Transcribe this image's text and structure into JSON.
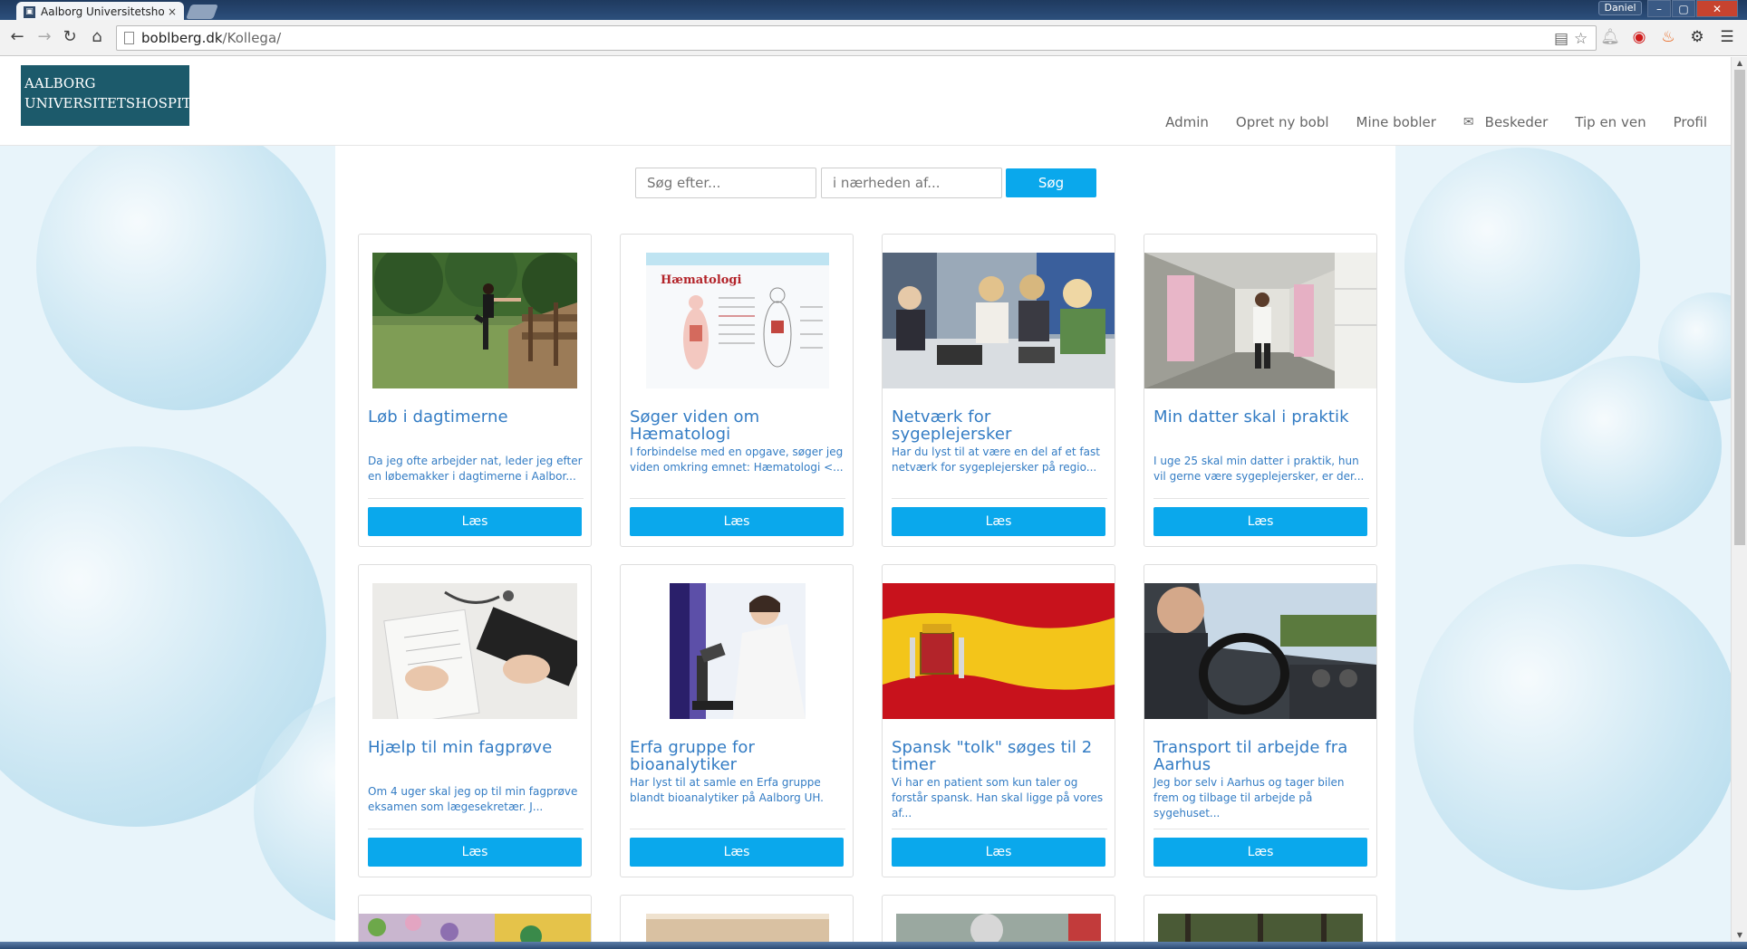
{
  "browser": {
    "tab_title": "Aalborg Universitetshospi",
    "tab_close": "×",
    "user_name": "Daniel",
    "url_domain": "boblberg.dk",
    "url_path": "/Kollega/",
    "win_min": "–",
    "win_max": "▢",
    "win_close": "✕",
    "icons": [
      "back-icon",
      "forward-icon",
      "reload-icon",
      "home-icon",
      "reader-icon",
      "star-icon",
      "bell-icon",
      "opera-icon",
      "fire-icon",
      "gear-icon",
      "menu-icon"
    ]
  },
  "header": {
    "logo_line1": "AALBORG",
    "logo_line2": "UNIVERSITETSHOSPITAL",
    "nav": {
      "admin": "Admin",
      "opret": "Opret ny bobl",
      "mine": "Mine bobler",
      "beskeder": "Beskeder",
      "tip": "Tip en ven",
      "profil": "Profil"
    }
  },
  "search": {
    "query_placeholder": "Søg efter...",
    "location_placeholder": "i nærheden af...",
    "button": "Søg"
  },
  "cards": [
    {
      "title": "Løb i dagtimerne",
      "desc": "Da jeg ofte arbejder nat, leder jeg efter en løbemakker i dagtimerne i Aalbor...",
      "button": "Læs"
    },
    {
      "title": "Søger viden om Hæmatologi",
      "desc": "I forbindelse med en opgave, søger jeg viden omkring emnet: Hæmatologi <...",
      "button": "Læs",
      "image_text": "Hæmatologi"
    },
    {
      "title": "Netværk for sygeplejersker",
      "desc": "Har du lyst til at være en del af et fast netværk for sygeplejersker på regio...",
      "button": "Læs"
    },
    {
      "title": "Min datter skal i praktik",
      "desc": "I uge 25 skal min datter i praktik, hun vil gerne være sygeplejersker, er der...",
      "button": "Læs"
    },
    {
      "title": "Hjælp til min fagprøve",
      "desc": "Om 4 uger skal jeg op til min fagprøve eksamen som lægesekretær. J...",
      "button": "Læs"
    },
    {
      "title": "Erfa gruppe for bioanalytiker",
      "desc": "Har lyst til at samle en Erfa gruppe blandt bioanalytiker på Aalborg UH.",
      "button": "Læs"
    },
    {
      "title": "Spansk \"tolk\" søges til 2 timer",
      "desc": "Vi har en patient som kun taler og forstår spansk. Han skal ligge på vores af...",
      "button": "Læs"
    },
    {
      "title": "Transport til arbejde fra Aarhus",
      "desc": "Jeg bor selv i Aarhus og tager bilen frem og tilbage til arbejde på sygehuset...",
      "button": "Læs"
    }
  ],
  "colors": {
    "accent": "#0aa8ec",
    "link": "#337cc4",
    "logo_bg": "#1c5a6b"
  }
}
